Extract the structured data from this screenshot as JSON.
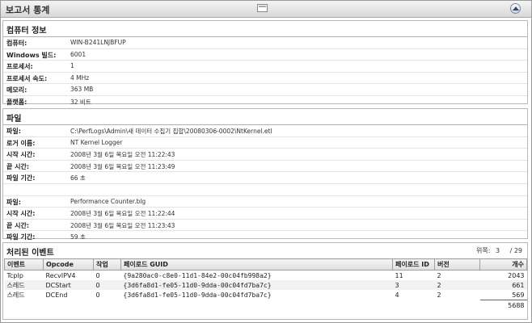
{
  "window": {
    "title": "보고서 통계"
  },
  "computer": {
    "heading": "컴퓨터 정보",
    "rows": [
      {
        "label": "컴퓨터:",
        "value": "WIN-B241LNJBFUP"
      },
      {
        "label": "Windows 빌드:",
        "value": "6001"
      },
      {
        "label": "프로세서:",
        "value": "1"
      },
      {
        "label": "프로세서 속도:",
        "value": "4 MHz"
      },
      {
        "label": "메모리:",
        "value": "363 MB"
      },
      {
        "label": "플랫폼:",
        "value": "32 비트"
      }
    ]
  },
  "files": {
    "heading": "파일",
    "group1": [
      {
        "label": "파일:",
        "value": "C:\\PerfLogs\\Admin\\새 데이터 수집기 집합\\20080306-0002\\NtKernel.etl"
      },
      {
        "label": "로거 이름:",
        "value": "NT Kernel Logger"
      },
      {
        "label": "시작 시간:",
        "value": "2008년 3월 6일 목요일 오전 11:22:43"
      },
      {
        "label": "끝 시간:",
        "value": "2008년 3월 6일 목요일 오전 11:23:49"
      },
      {
        "label": "파일 기간:",
        "value": "66 초"
      }
    ],
    "group2": [
      {
        "label": "파일:",
        "value": "Performance Counter.blg"
      },
      {
        "label": "시작 시간:",
        "value": "2008년 3월 6일 목요일 오전 11:22:44"
      },
      {
        "label": "끝 시간:",
        "value": "2008년 3월 6일 목요일 오전 11:23:43"
      },
      {
        "label": "파일 기간:",
        "value": "59 초"
      }
    ]
  },
  "events": {
    "heading": "처리된 이벤트",
    "pager": {
      "label": "위쪽:",
      "current": "3",
      "total": "/ 29"
    },
    "columns": [
      "이벤트",
      "Opcode",
      "작업",
      "페이로드 GUID",
      "페이로드 ID",
      "버전",
      "개수"
    ],
    "rows": [
      {
        "event": "TcpIp",
        "opcode": "RecvIPV4",
        "task": "0",
        "guid": "{9a280ac0-c8e0-11d1-84e2-00c04fb998a2}",
        "pid": "11",
        "version": "2",
        "count": "2043"
      },
      {
        "event": "스레드",
        "opcode": "DCStart",
        "task": "0",
        "guid": "{3d6fa8d1-fe05-11d0-9dda-00c04fd7ba7c}",
        "pid": "3",
        "version": "2",
        "count": "661"
      },
      {
        "event": "스레드",
        "opcode": "DCEnd",
        "task": "0",
        "guid": "{3d6fa8d1-fe05-11d0-9dda-00c04fd7ba7c}",
        "pid": "4",
        "version": "2",
        "count": "569"
      }
    ],
    "total": "5688"
  }
}
